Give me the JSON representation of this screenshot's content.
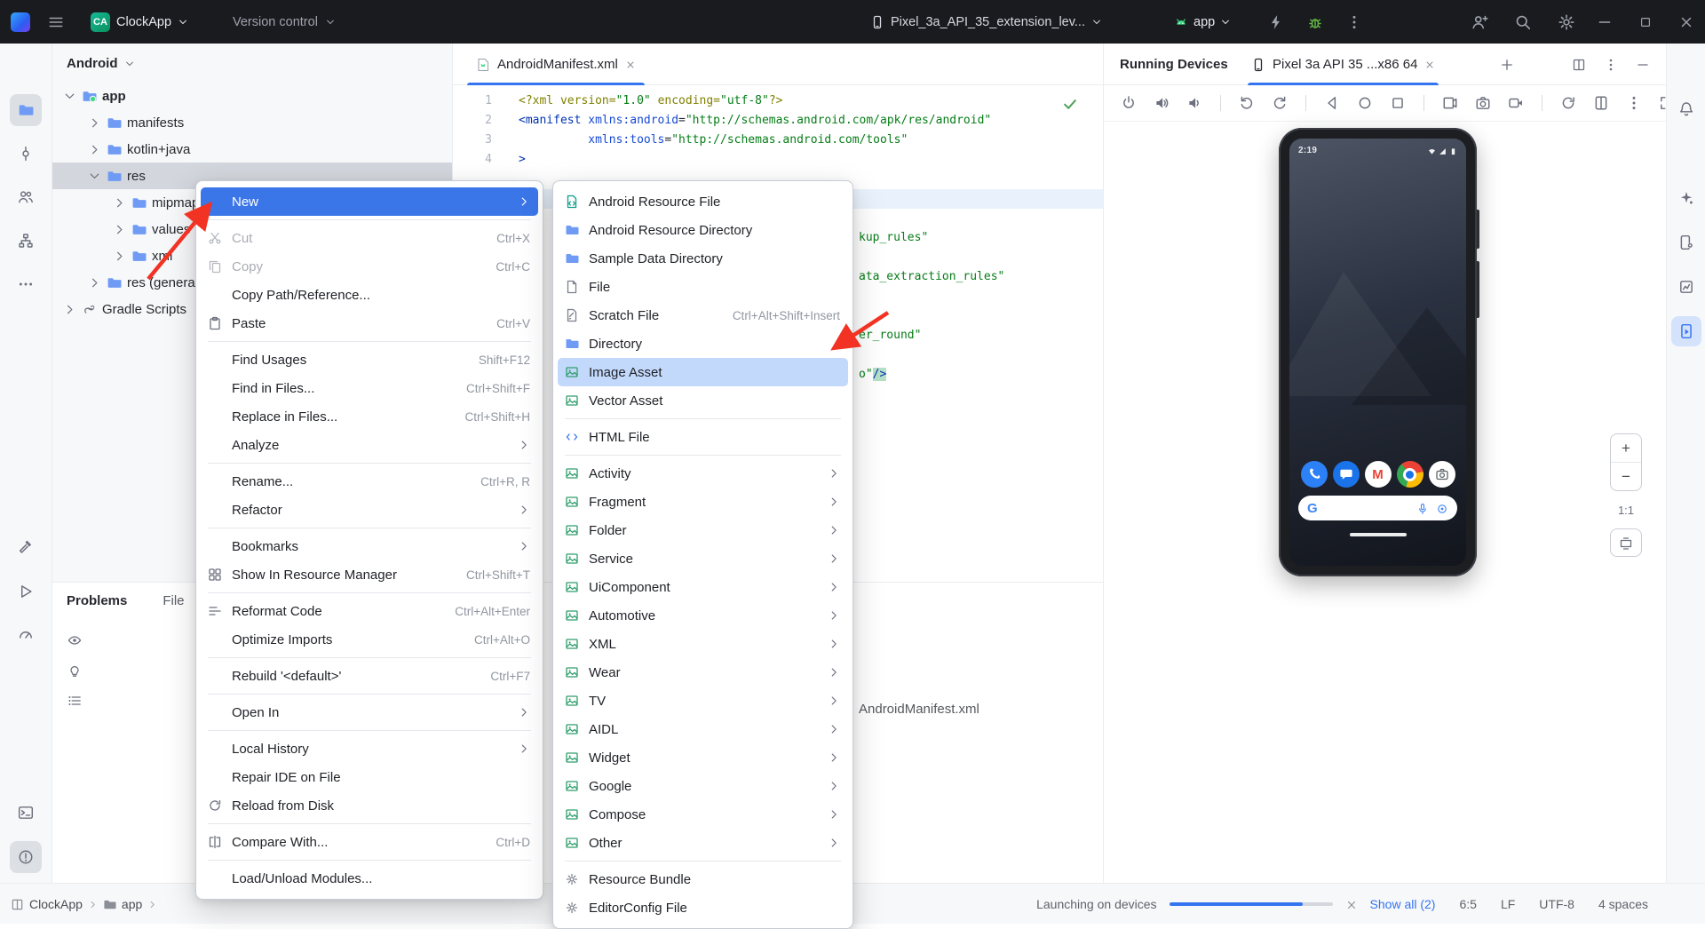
{
  "colors": {
    "accent": "#3574F0",
    "menu_selection": "#3B76E8",
    "submenu_selection": "#C3D9FB",
    "arrow_red": "#F23222",
    "android_green": "#3DDC84",
    "string_green": "#067D17",
    "tag_blue": "#0033B3"
  },
  "title_bar": {
    "project_badge": "CA",
    "project_name": "ClockApp",
    "vcs_widget": "Version control",
    "device_selector": "Pixel_3a_API_35_extension_lev...",
    "run_config": "app"
  },
  "left_stripe": {
    "top": [
      {
        "name": "project",
        "icon": "folder",
        "active": true,
        "tint": "blue"
      },
      {
        "name": "commit",
        "icon": "commit"
      },
      {
        "name": "pull-requests",
        "icon": "users"
      },
      {
        "name": "structure",
        "icon": "structure"
      },
      {
        "name": "more-tool-windows",
        "icon": "moreH"
      }
    ],
    "middle": [
      {
        "name": "build",
        "icon": "hammer"
      },
      {
        "name": "run",
        "icon": "runTri"
      },
      {
        "name": "profiler",
        "icon": "gauge"
      }
    ],
    "bottom": [
      {
        "name": "terminal",
        "icon": "terminal"
      },
      {
        "name": "problems",
        "icon": "problems",
        "active": true
      },
      {
        "name": "version-control",
        "icon": "gitBranch"
      }
    ]
  },
  "right_stripe": [
    {
      "name": "notifications",
      "icon": "bell"
    },
    {
      "name": "ai-assistant",
      "icon": "sparkle"
    },
    {
      "name": "device-manager",
      "icon": "deviceMgr"
    },
    {
      "name": "app-quality-insights",
      "icon": "insights"
    },
    {
      "name": "running-devices",
      "icon": "runDev",
      "active": true,
      "accent": true
    }
  ],
  "project_panel": {
    "view_selector": "Android",
    "tree": [
      {
        "label": "app",
        "level": 0,
        "chevron": "down",
        "icon": "folderApp",
        "bold": true
      },
      {
        "label": "manifests",
        "level": 1,
        "chevron": "right",
        "icon": "folder"
      },
      {
        "label": "kotlin+java",
        "level": 1,
        "chevron": "right",
        "icon": "folder"
      },
      {
        "label": "res",
        "level": 1,
        "chevron": "down",
        "icon": "folder",
        "selected": true
      },
      {
        "label": "mipmap",
        "level": 2,
        "chevron": "right",
        "icon": "folder"
      },
      {
        "label": "values",
        "level": 2,
        "chevron": "right",
        "icon": "folder"
      },
      {
        "label": "xml",
        "level": 2,
        "chevron": "right",
        "icon": "folder"
      },
      {
        "label": "res (generated)",
        "level": 1,
        "chevron": "right",
        "icon": "folder"
      },
      {
        "label": "Gradle Scripts",
        "level": 0,
        "chevron": "right",
        "icon": "gradle"
      }
    ]
  },
  "editor": {
    "tab": {
      "label": "AndroidManifest.xml"
    },
    "gutter": [
      "1",
      "2",
      "3",
      "4"
    ],
    "lines": [
      [
        [
          "<?xml ",
          "pl"
        ],
        [
          "version=",
          "pl"
        ],
        [
          "\"1.0\"",
          "st"
        ],
        [
          " ",
          "pl"
        ],
        [
          "encoding=",
          "pl"
        ],
        [
          "\"utf-8\"",
          "st"
        ],
        [
          "?>",
          "pl"
        ]
      ],
      [
        [
          "<manifest ",
          "tg"
        ],
        [
          "xmlns:android",
          "at"
        ],
        [
          "=",
          "tx"
        ],
        [
          "\"http://schemas.android.com/apk/res/android\"",
          "st"
        ]
      ],
      [
        [
          "          ",
          "tx"
        ],
        [
          "xmlns:tools",
          "at"
        ],
        [
          "=",
          "tx"
        ],
        [
          "\"http://schemas.android.com/tools\"",
          "st"
        ]
      ],
      [
        [
          ">",
          "tg"
        ]
      ]
    ],
    "fragments": [
      {
        "line": 8,
        "tokens": [
          [
            "kup_rules\"",
            "st"
          ]
        ]
      },
      {
        "line": 10,
        "tokens": [
          [
            "ata_extraction_rules\"",
            "st"
          ]
        ]
      },
      {
        "line": 13,
        "tokens": [
          [
            "er_round\"",
            "st"
          ]
        ]
      },
      {
        "line": 15,
        "tokens": [
          [
            "o\"",
            "st"
          ],
          [
            "/>",
            "hl"
          ]
        ]
      }
    ]
  },
  "context_menu": {
    "items": [
      {
        "label": "New",
        "submenu": true,
        "selected": "primary"
      },
      {
        "sep": true
      },
      {
        "label": "Cut",
        "shortcut": "Ctrl+X",
        "icon": "cut",
        "disabled": true
      },
      {
        "label": "Copy",
        "shortcut": "Ctrl+C",
        "icon": "copy",
        "disabled": true
      },
      {
        "label": "Copy Path/Reference..."
      },
      {
        "label": "Paste",
        "shortcut": "Ctrl+V",
        "icon": "paste"
      },
      {
        "sep": true
      },
      {
        "label": "Find Usages",
        "shortcut": "Shift+F12"
      },
      {
        "label": "Find in Files...",
        "shortcut": "Ctrl+Shift+F"
      },
      {
        "label": "Replace in Files...",
        "shortcut": "Ctrl+Shift+H"
      },
      {
        "label": "Analyze",
        "submenu": true
      },
      {
        "sep": true
      },
      {
        "label": "Rename...",
        "shortcut": "Ctrl+R, R"
      },
      {
        "label": "Refactor",
        "submenu": true
      },
      {
        "sep": true
      },
      {
        "label": "Bookmarks",
        "submenu": true
      },
      {
        "label": "Show In Resource Manager",
        "shortcut": "Ctrl+Shift+T",
        "icon": "resMgr"
      },
      {
        "sep": true
      },
      {
        "label": "Reformat Code",
        "shortcut": "Ctrl+Alt+Enter",
        "icon": "reformat"
      },
      {
        "label": "Optimize Imports",
        "shortcut": "Ctrl+Alt+O"
      },
      {
        "sep": true
      },
      {
        "label": "Rebuild '<default>'",
        "shortcut": "Ctrl+F7"
      },
      {
        "sep": true
      },
      {
        "label": "Open In",
        "submenu": true
      },
      {
        "sep": true
      },
      {
        "label": "Local History",
        "submenu": true
      },
      {
        "label": "Repair IDE on File"
      },
      {
        "label": "Reload from Disk",
        "icon": "refresh"
      },
      {
        "sep": true
      },
      {
        "label": "Compare With...",
        "shortcut": "Ctrl+D",
        "icon": "compare"
      },
      {
        "sep": true
      },
      {
        "label": "Load/Unload Modules..."
      }
    ]
  },
  "new_submenu": {
    "items": [
      {
        "label": "Android Resource File",
        "icon": "resFile"
      },
      {
        "label": "Android Resource Directory",
        "icon": "folder"
      },
      {
        "label": "Sample Data Directory",
        "icon": "folder"
      },
      {
        "label": "File",
        "icon": "fileIc"
      },
      {
        "label": "Scratch File",
        "shortcut": "Ctrl+Alt+Shift+Insert",
        "icon": "scratch"
      },
      {
        "label": "Directory",
        "icon": "folder"
      },
      {
        "label": "Image Asset",
        "icon": "asset",
        "selected": "soft"
      },
      {
        "label": "Vector Asset",
        "icon": "asset"
      },
      {
        "sep": true
      },
      {
        "label": "HTML File",
        "icon": "html"
      },
      {
        "sep": true
      },
      {
        "label": "Activity",
        "icon": "asset",
        "submenu": true
      },
      {
        "label": "Fragment",
        "icon": "asset",
        "submenu": true
      },
      {
        "label": "Folder",
        "icon": "asset",
        "submenu": true
      },
      {
        "label": "Service",
        "icon": "asset",
        "submenu": true
      },
      {
        "label": "UiComponent",
        "icon": "asset",
        "submenu": true
      },
      {
        "label": "Automotive",
        "icon": "asset",
        "submenu": true
      },
      {
        "label": "XML",
        "icon": "asset",
        "submenu": true
      },
      {
        "label": "Wear",
        "icon": "asset",
        "submenu": true
      },
      {
        "label": "TV",
        "icon": "asset",
        "submenu": true
      },
      {
        "label": "AIDL",
        "icon": "asset",
        "submenu": true
      },
      {
        "label": "Widget",
        "icon": "asset",
        "submenu": true
      },
      {
        "label": "Google",
        "icon": "asset",
        "submenu": true
      },
      {
        "label": "Compose",
        "icon": "asset",
        "submenu": true
      },
      {
        "label": "Other",
        "icon": "asset",
        "submenu": true
      },
      {
        "sep": true
      },
      {
        "label": "Resource Bundle",
        "icon": "bundle"
      },
      {
        "label": "EditorConfig File",
        "icon": "bundle"
      }
    ]
  },
  "problems_panel": {
    "title": "Problems",
    "tab": "File",
    "content_file": "AndroidManifest.xml"
  },
  "running_devices": {
    "title": "Running Devices",
    "tab": "Pixel 3a API 35 ...x86 64",
    "toolbar": [
      "power",
      "volUp",
      "volDown",
      "sep",
      "rotL",
      "rotR",
      "sep",
      "navBack",
      "navHome",
      "navOver",
      "sep",
      "snapshot",
      "camera",
      "record",
      "sep",
      "restart",
      "fold",
      "kebab"
    ],
    "zoom_controls": {
      "zoom_in": "+",
      "zoom_out": "−",
      "ratio": "1:1"
    },
    "device": {
      "status_time": "2:19",
      "dock": [
        "phone",
        "messages",
        "gmail",
        "chrome",
        "camera"
      ],
      "gmail_letter": "M",
      "search_g": "G"
    }
  },
  "status_bar": {
    "breadcrumbs": [
      {
        "label": "ClockApp",
        "icon": "project"
      },
      {
        "label": "app",
        "icon": "folder"
      }
    ],
    "progress_label": "Launching on devices",
    "show_all": "Show all (2)",
    "caret_position": "6:5",
    "line_separator": "LF",
    "encoding": "UTF-8",
    "indent": "4 spaces"
  }
}
